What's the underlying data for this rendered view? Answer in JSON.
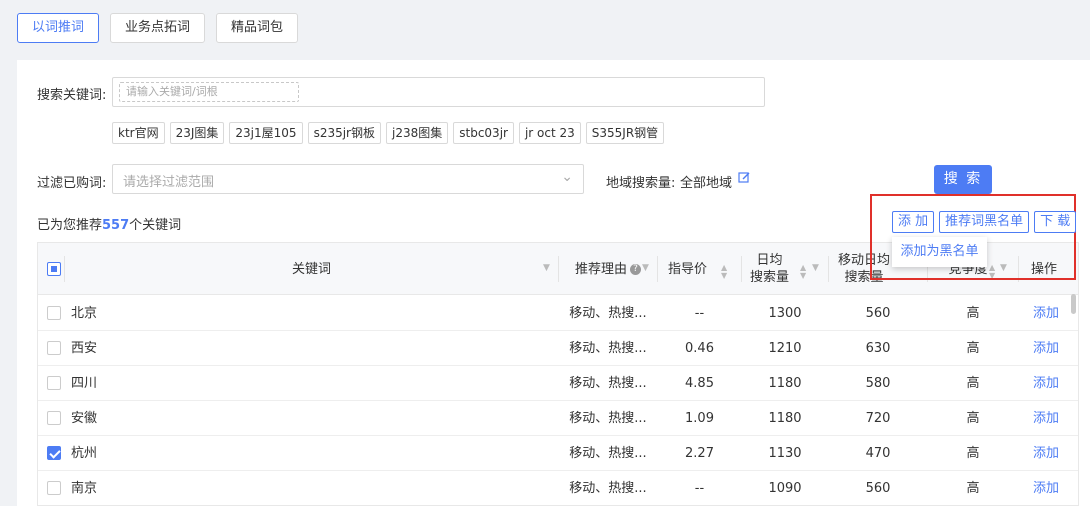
{
  "tabs": [
    "以词推词",
    "业务点拓词",
    "精品词包"
  ],
  "search": {
    "label": "搜索关键词:",
    "placeholder": "请输入关键词/词根",
    "chips": [
      "ktr官网",
      "23J图集",
      "23j1屋105",
      "s235jr钢板",
      "j238图集",
      "stbc03jr",
      "jr oct 23",
      "S355JR钢管"
    ]
  },
  "filter": {
    "label": "过滤已购词:",
    "placeholder": "请选择过滤范围",
    "region_label": "地域搜索量:",
    "region_value": "全部地域"
  },
  "search_button": "搜 索",
  "summary": {
    "prefix": "已为您推荐",
    "count": "557",
    "suffix": "个关键词"
  },
  "actions": {
    "add": "添 加",
    "blacklist": "推荐词黑名单",
    "download": "下 载"
  },
  "dropdown": {
    "item": "添加为黑名单"
  },
  "columns": {
    "keyword": "关键词",
    "reason": "推荐理由",
    "price": "指导价",
    "daily_1": "日均",
    "daily_2": "搜索量",
    "mobile_1": "移动日均",
    "mobile_2": "搜索量",
    "competition": "竞争度",
    "op": "操作"
  },
  "rows": [
    {
      "keyword": "北京",
      "reason": "移动、热搜...",
      "price": "--",
      "daily": "1300",
      "mobile": "560",
      "competition": "高",
      "op": "添加",
      "checked": false
    },
    {
      "keyword": "西安",
      "reason": "移动、热搜...",
      "price": "0.46",
      "daily": "1210",
      "mobile": "630",
      "competition": "高",
      "op": "添加",
      "checked": false
    },
    {
      "keyword": "四川",
      "reason": "移动、热搜...",
      "price": "4.85",
      "daily": "1180",
      "mobile": "580",
      "competition": "高",
      "op": "添加",
      "checked": false
    },
    {
      "keyword": "安徽",
      "reason": "移动、热搜...",
      "price": "1.09",
      "daily": "1180",
      "mobile": "720",
      "competition": "高",
      "op": "添加",
      "checked": false
    },
    {
      "keyword": "杭州",
      "reason": "移动、热搜...",
      "price": "2.27",
      "daily": "1130",
      "mobile": "470",
      "competition": "高",
      "op": "添加",
      "checked": true
    },
    {
      "keyword": "南京",
      "reason": "移动、热搜...",
      "price": "--",
      "daily": "1090",
      "mobile": "560",
      "competition": "高",
      "op": "添加",
      "checked": false
    }
  ],
  "colors": {
    "accent": "#4d7cf4",
    "highlight": "#e0302a"
  }
}
